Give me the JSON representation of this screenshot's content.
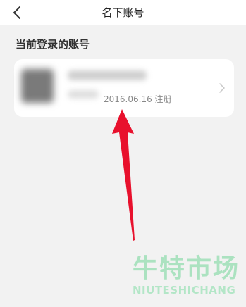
{
  "header": {
    "title": "名下账号",
    "back_icon": "chevron-left-icon"
  },
  "section": {
    "title": "当前登录的账号"
  },
  "account": {
    "registered": "2016.06.16 注册",
    "chevron_icon": "chevron-right-icon"
  },
  "annotation": {
    "arrow_color": "#e8112d"
  },
  "watermark": {
    "text_cn": "牛特市场",
    "text_en": "NIUTESHICHANG"
  }
}
